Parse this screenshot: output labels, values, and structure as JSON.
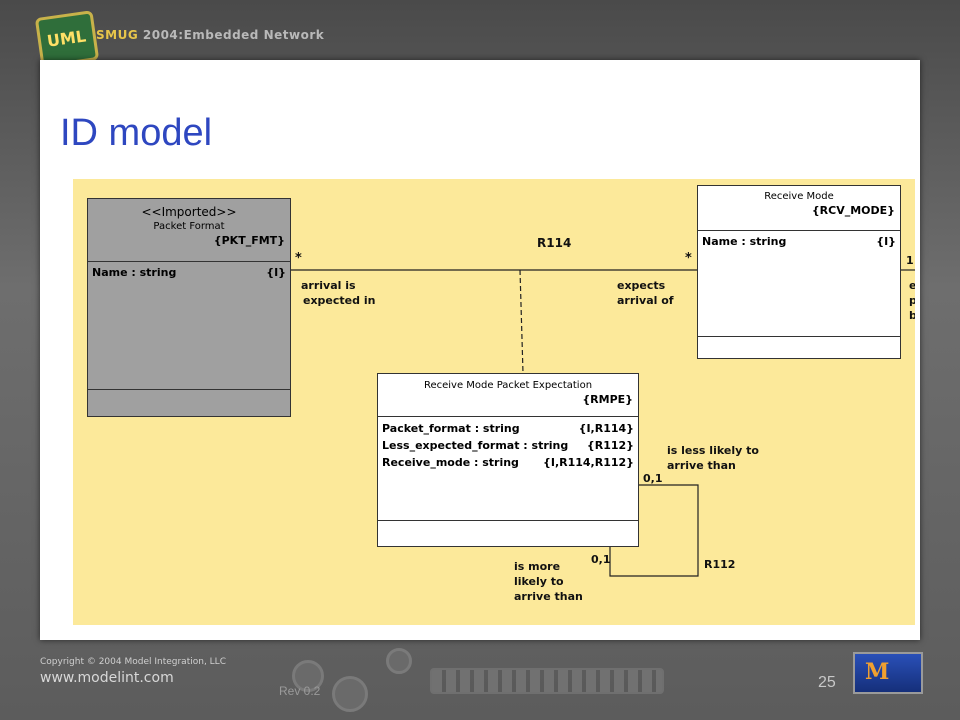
{
  "header": {
    "logo_text": "UML",
    "banner_brand": "SMUG",
    "banner_rest": " 2004:Embedded Network"
  },
  "slide": {
    "title": "ID model",
    "page_number": "25",
    "revision": "Rev 0.2"
  },
  "footer": {
    "copyright": "Copyright © 2004 Model Integration, LLC",
    "url": "www.modelint.com",
    "logo_glyph": "M"
  },
  "diagram": {
    "pkt_fmt": {
      "stereotype": "<<Imported>>",
      "name": "Packet Format",
      "key": "{PKT_FMT}",
      "attrs": [
        {
          "name": "Name : string",
          "tag": "{I}"
        }
      ]
    },
    "rcv_mode": {
      "name": "Receive Mode",
      "key": "{RCV_MODE}",
      "attrs": [
        {
          "name": "Name : string",
          "tag": "{I}"
        }
      ]
    },
    "rmpe": {
      "name": "Receive Mode Packet Expectation",
      "key": "{RMPE}",
      "attrs": [
        {
          "name": "Packet_format : string",
          "tag": "{I,R114}"
        },
        {
          "name": "Less_expected_format : string",
          "tag": "{R112}"
        },
        {
          "name": "Receive_mode : string",
          "tag": "{I,R114,R112}"
        }
      ]
    },
    "r114": {
      "label": "R114",
      "mult_left": "*",
      "mult_right": "*",
      "phrase_left": [
        "arrival is",
        "expected in"
      ],
      "phrase_right": [
        "expects",
        "arrival of"
      ]
    },
    "r112": {
      "label": "R112",
      "mult_top": "0,1",
      "mult_bottom": "0,1",
      "phrase_top": [
        "is less likely to",
        "arrive than"
      ],
      "phrase_bottom": [
        "is more",
        "likely to",
        "arrive than"
      ]
    },
    "offscreen": {
      "mult": "1",
      "phrase": [
        "e",
        "p",
        "b"
      ]
    }
  }
}
